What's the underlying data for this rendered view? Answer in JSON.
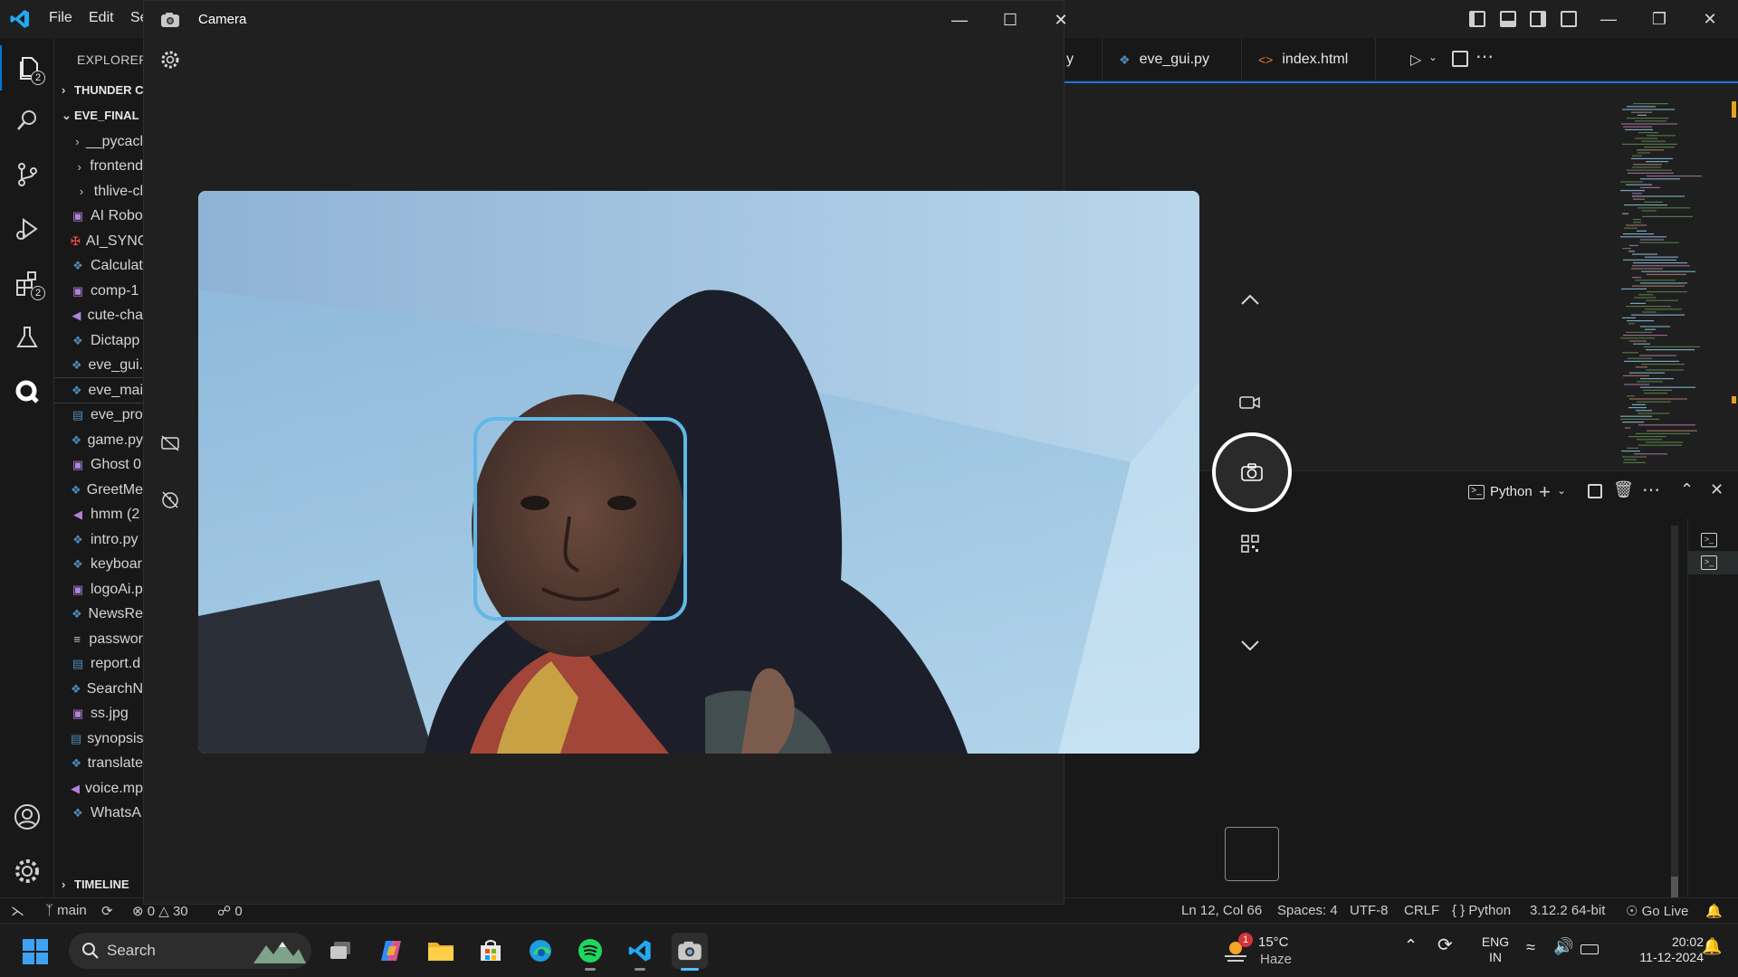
{
  "vscode": {
    "menu": [
      "File",
      "Edit",
      "Se"
    ],
    "explorer_title": "EXPLORER",
    "sections": {
      "thunder": "THUNDER C",
      "project": "EVE_FINAL",
      "timeline": "TIMELINE"
    },
    "activity_badges": {
      "explorer": "2",
      "extensions": "2"
    },
    "files": [
      {
        "name": "__pycacl",
        "icon": "chevron-right-icon",
        "type": "folder"
      },
      {
        "name": "frontend",
        "icon": "chevron-right-icon",
        "type": "folder"
      },
      {
        "name": "thlive-cl",
        "icon": "chevron-right-icon",
        "type": "folder"
      },
      {
        "name": "AI Robo",
        "icon": "image-file-icon",
        "type": "file",
        "color": "#b180d7"
      },
      {
        "name": "AI_SYNC",
        "icon": "pdf-file-icon",
        "type": "file",
        "color": "#f14c4c"
      },
      {
        "name": "Calculat",
        "icon": "python-file-icon",
        "type": "file",
        "color": "#4b8bbe"
      },
      {
        "name": "comp-1",
        "icon": "image-file-icon",
        "type": "file",
        "color": "#b180d7"
      },
      {
        "name": "cute-cha",
        "icon": "audio-file-icon",
        "type": "file",
        "color": "#b180d7"
      },
      {
        "name": "Dictapp",
        "icon": "python-file-icon",
        "type": "file",
        "color": "#4b8bbe"
      },
      {
        "name": "eve_gui.",
        "icon": "python-file-icon",
        "type": "file",
        "color": "#4b8bbe"
      },
      {
        "name": "eve_mai",
        "icon": "python-file-icon",
        "type": "file",
        "color": "#4b8bbe",
        "selected": true
      },
      {
        "name": "eve_pro",
        "icon": "word-file-icon",
        "type": "file",
        "color": "#4b8bbe"
      },
      {
        "name": "game.py",
        "icon": "python-file-icon",
        "type": "file",
        "color": "#4b8bbe"
      },
      {
        "name": "Ghost 0",
        "icon": "image-file-icon",
        "type": "file",
        "color": "#b180d7"
      },
      {
        "name": "GreetMe",
        "icon": "python-file-icon",
        "type": "file",
        "color": "#4b8bbe"
      },
      {
        "name": "hmm (2",
        "icon": "audio-file-icon",
        "type": "file",
        "color": "#b180d7"
      },
      {
        "name": "intro.py",
        "icon": "python-file-icon",
        "type": "file",
        "color": "#4b8bbe"
      },
      {
        "name": "keyboar",
        "icon": "python-file-icon",
        "type": "file",
        "color": "#4b8bbe"
      },
      {
        "name": "logoAi.p",
        "icon": "image-file-icon",
        "type": "file",
        "color": "#b180d7"
      },
      {
        "name": "NewsRe",
        "icon": "python-file-icon",
        "type": "file",
        "color": "#4b8bbe"
      },
      {
        "name": "passwor",
        "icon": "text-file-icon",
        "type": "file",
        "color": "#c5c5c5"
      },
      {
        "name": "report.d",
        "icon": "word-file-icon",
        "type": "file",
        "color": "#4b8bbe"
      },
      {
        "name": "SearchN",
        "icon": "python-file-icon",
        "type": "file",
        "color": "#4b8bbe"
      },
      {
        "name": "ss.jpg",
        "icon": "image-file-icon",
        "type": "file",
        "color": "#b180d7"
      },
      {
        "name": "synopsis",
        "icon": "word-file-icon",
        "type": "file",
        "color": "#4b8bbe"
      },
      {
        "name": "translate",
        "icon": "python-file-icon",
        "type": "file",
        "color": "#4b8bbe"
      },
      {
        "name": "voice.mp",
        "icon": "audio-file-icon",
        "type": "file",
        "color": "#b180d7"
      },
      {
        "name": "WhatsA",
        "icon": "python-file-icon",
        "type": "file",
        "color": "#4b8bbe"
      }
    ],
    "tabs": [
      {
        "label": "y",
        "icon": ""
      },
      {
        "label": "eve_gui.py",
        "icon": "python-file-icon"
      },
      {
        "label": "index.html",
        "icon": "html-file-icon"
      }
    ],
    "panel": {
      "terminal_label": "Python"
    },
    "status": {
      "branch": "main",
      "errors": "0",
      "warnings": "30",
      "ports": "0",
      "position": "Ln 12, Col 66",
      "spaces": "Spaces: 4",
      "encoding": "UTF-8",
      "eol": "CRLF",
      "language": "Python",
      "interpreter": "3.12.2 64-bit",
      "golive": "Go Live"
    }
  },
  "camera": {
    "title": "Camera"
  },
  "taskbar": {
    "search_label": "Search",
    "weather": {
      "temp": "15°C",
      "condition": "Haze",
      "badge": "1"
    },
    "lang": {
      "line1": "ENG",
      "line2": "IN"
    },
    "time": "20:02",
    "date": "11-12-2024"
  },
  "colors": {
    "accent": "#0078d4",
    "camera_focus": "#5fb8e6",
    "active_indicator": "#4cc2ff"
  }
}
